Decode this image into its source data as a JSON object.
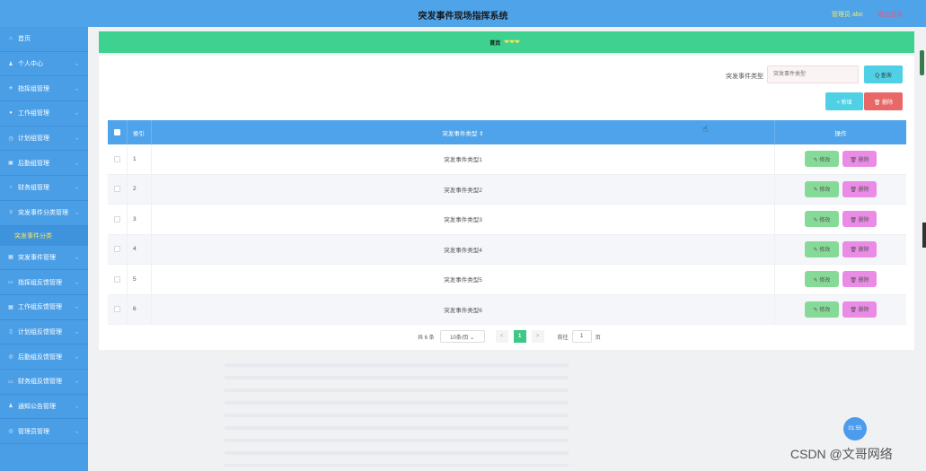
{
  "header": {
    "title": "突发事件现场指挥系统",
    "admin": "管理员 abo",
    "logout": "退出登录"
  },
  "sidebar": {
    "items": [
      {
        "label": "首页",
        "icon": "home-icon",
        "glyph": "⌂"
      },
      {
        "label": "个人中心",
        "icon": "user-icon",
        "glyph": "♟"
      },
      {
        "label": "指挥组管理",
        "icon": "send-icon",
        "glyph": "✈"
      },
      {
        "label": "工作组管理",
        "icon": "pin-icon",
        "glyph": "●"
      },
      {
        "label": "计划组管理",
        "icon": "clock-icon",
        "glyph": "◷"
      },
      {
        "label": "后勤组管理",
        "icon": "building-icon",
        "glyph": "▣"
      },
      {
        "label": "财务组管理",
        "icon": "circle-icon",
        "glyph": "○"
      },
      {
        "label": "突发事件分类管理",
        "icon": "menu-icon",
        "glyph": "≡"
      },
      {
        "label": "突发事件管理",
        "icon": "grid-icon",
        "glyph": "▦"
      },
      {
        "label": "指挥组反馈管理",
        "icon": "doc-icon",
        "glyph": "▭"
      },
      {
        "label": "工作组反馈管理",
        "icon": "grid-icon",
        "glyph": "▦"
      },
      {
        "label": "计划组反馈管理",
        "icon": "doc-icon",
        "glyph": "▯"
      },
      {
        "label": "后勤组反馈管理",
        "icon": "settings-icon",
        "glyph": "◎"
      },
      {
        "label": "财务组反馈管理",
        "icon": "doc-icon",
        "glyph": "▭"
      },
      {
        "label": "通知公告管理",
        "icon": "user-icon",
        "glyph": "♟"
      },
      {
        "label": "管理员管理",
        "icon": "settings-icon",
        "glyph": "◎"
      }
    ],
    "sub_item": "突发事件分类"
  },
  "breadcrumb": {
    "home": "首页",
    "sep": "❤❤❤"
  },
  "search": {
    "label": "突发事件类型",
    "placeholder": "突发事件类型",
    "query_button": "Q 查询"
  },
  "toolbar": {
    "add_button": "+ 新增",
    "delete_button": "🗑 删除"
  },
  "table": {
    "headers": {
      "index": "索引",
      "type": "突发事件类型 ⇕",
      "op": "操作"
    },
    "rows": [
      {
        "index": "1",
        "type": "突发事件类型1"
      },
      {
        "index": "2",
        "type": "突发事件类型2"
      },
      {
        "index": "3",
        "type": "突发事件类型3"
      },
      {
        "index": "4",
        "type": "突发事件类型4"
      },
      {
        "index": "5",
        "type": "突发事件类型5"
      },
      {
        "index": "6",
        "type": "突发事件类型6"
      }
    ],
    "edit_label": "✎ 修改",
    "delete_label": "🗑 删除"
  },
  "pager": {
    "total": "共 6 条",
    "size": "10条/页 ⌄",
    "prev": "<",
    "page": "1",
    "next": ">",
    "goto_prefix": "前往",
    "goto_value": "1",
    "goto_suffix": "页"
  },
  "timer": "01:55",
  "watermark": "CSDN @文哥网络"
}
